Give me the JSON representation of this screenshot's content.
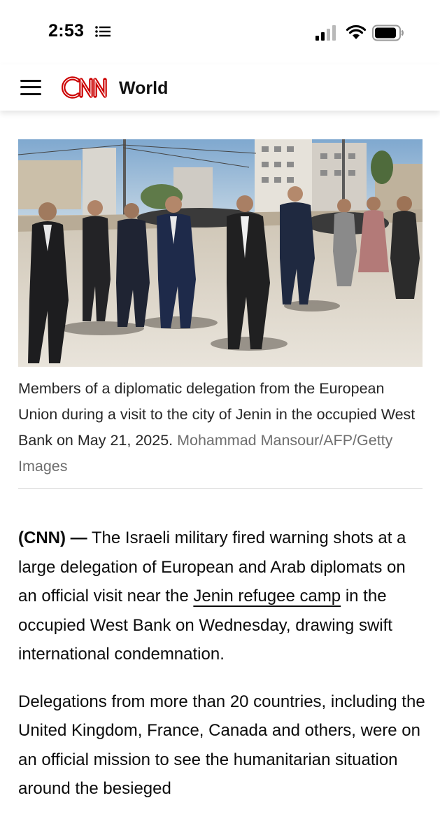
{
  "status_bar": {
    "time": "2:53",
    "icons": [
      "list-icon",
      "signal-icon",
      "wifi-icon",
      "battery-icon"
    ]
  },
  "header": {
    "menu_icon": "hamburger-menu-icon",
    "logo_text": "CNN",
    "section": "World",
    "brand_color": "#cc0000"
  },
  "photo": {
    "caption": "Members of a diplomatic delegation from the European Union during a visit to the city of Jenin in the occupied West Bank on May 21, 2025.",
    "credit": "Mohammad Mansour/AFP/Getty Images"
  },
  "article": {
    "p1_lead": "(CNN) —",
    "p1_text_a": " The Israeli military fired warning shots at a large delegation of European and Arab diplomats on an official visit near the ",
    "p1_link": "Jenin refugee camp",
    "p1_text_b": " in the occupied West Bank on Wednesday, drawing swift international condemnation.",
    "p2": "Delegations from more than 20 countries, including the United Kingdom, France, Canada and others, were on an official mission to see the humanitarian situation around the besieged"
  }
}
